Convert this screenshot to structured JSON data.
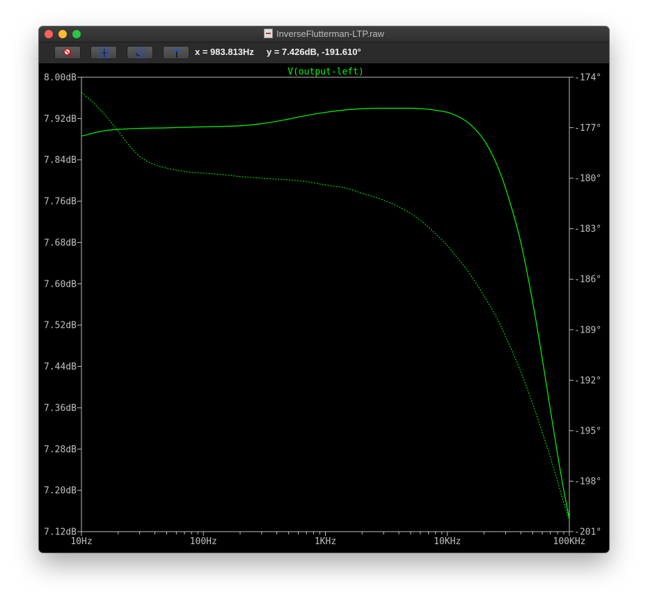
{
  "window": {
    "title": "InverseFlutterman-LTP.raw",
    "cursor_x_label": "x = 983.813Hz",
    "cursor_y_label": "y = 7.426dB, -191.610°"
  },
  "toolbar": {
    "buttons": [
      {
        "name": "zoom-button",
        "icon": "magnifier-icon"
      },
      {
        "name": "autorange-button",
        "icon": "autorange-icon"
      },
      {
        "name": "zoom-back-button",
        "icon": "zoom-back-icon"
      },
      {
        "name": "probe-button",
        "icon": "probe-icon"
      }
    ]
  },
  "chart_data": {
    "type": "line",
    "title": "V(output-left)",
    "x_scale": "log",
    "xlim": [
      10,
      100000
    ],
    "x_ticks": [
      {
        "value": 10,
        "label": "10Hz"
      },
      {
        "value": 100,
        "label": "100Hz"
      },
      {
        "value": 1000,
        "label": "1KHz"
      },
      {
        "value": 10000,
        "label": "10KHz"
      },
      {
        "value": 100000,
        "label": "100KHz"
      }
    ],
    "ylim": [
      7.12,
      8.0
    ],
    "y_ticks": [
      "8.00dB",
      "7.92dB",
      "7.84dB",
      "7.76dB",
      "7.68dB",
      "7.60dB",
      "7.52dB",
      "7.44dB",
      "7.36dB",
      "7.28dB",
      "7.20dB",
      "7.12dB"
    ],
    "y2lim": [
      -201,
      -174
    ],
    "y2_ticks": [
      "-174°",
      "-177°",
      "-180°",
      "-183°",
      "-186°",
      "-189°",
      "-192°",
      "-195°",
      "-198°",
      "-201°"
    ],
    "grid": false,
    "colors": {
      "trace": "#00ff00",
      "axis": "#c0c0c0",
      "background": "#000000",
      "title": "#00ff00"
    },
    "series": [
      {
        "name": "magnitude",
        "axis": "left",
        "style": "solid",
        "x": [
          10,
          15,
          20,
          30,
          50,
          70,
          100,
          150,
          200,
          300,
          500,
          700,
          1000,
          1500,
          2000,
          3000,
          4000,
          5000,
          6000,
          7000,
          8000,
          10000,
          12000,
          15000,
          20000,
          25000,
          30000,
          40000,
          50000,
          60000,
          70000,
          80000,
          90000,
          100000
        ],
        "y": [
          7.886,
          7.896,
          7.899,
          7.901,
          7.902,
          7.903,
          7.904,
          7.905,
          7.906,
          7.91,
          7.919,
          7.926,
          7.932,
          7.937,
          7.939,
          7.94,
          7.94,
          7.94,
          7.939,
          7.938,
          7.936,
          7.932,
          7.925,
          7.911,
          7.878,
          7.835,
          7.785,
          7.68,
          7.565,
          7.455,
          7.355,
          7.27,
          7.2,
          7.145
        ]
      },
      {
        "name": "phase",
        "axis": "right",
        "style": "dotted",
        "x": [
          10,
          12,
          15,
          20,
          25,
          30,
          40,
          50,
          70,
          100,
          150,
          200,
          300,
          500,
          700,
          1000,
          1500,
          2000,
          3000,
          4000,
          5000,
          6000,
          7000,
          8000,
          10000,
          12000,
          15000,
          20000,
          25000,
          30000,
          40000,
          50000,
          60000,
          70000,
          80000,
          90000,
          100000
        ],
        "y": [
          -174.9,
          -175.4,
          -176.1,
          -177.2,
          -178.1,
          -178.7,
          -179.2,
          -179.4,
          -179.6,
          -179.7,
          -179.8,
          -179.9,
          -180.0,
          -180.1,
          -180.2,
          -180.4,
          -180.6,
          -180.9,
          -181.3,
          -181.7,
          -182.1,
          -182.5,
          -182.9,
          -183.3,
          -184.0,
          -184.7,
          -185.6,
          -187.0,
          -188.2,
          -189.4,
          -191.5,
          -193.4,
          -195.1,
          -196.6,
          -198.0,
          -199.3,
          -200.3
        ]
      }
    ]
  }
}
